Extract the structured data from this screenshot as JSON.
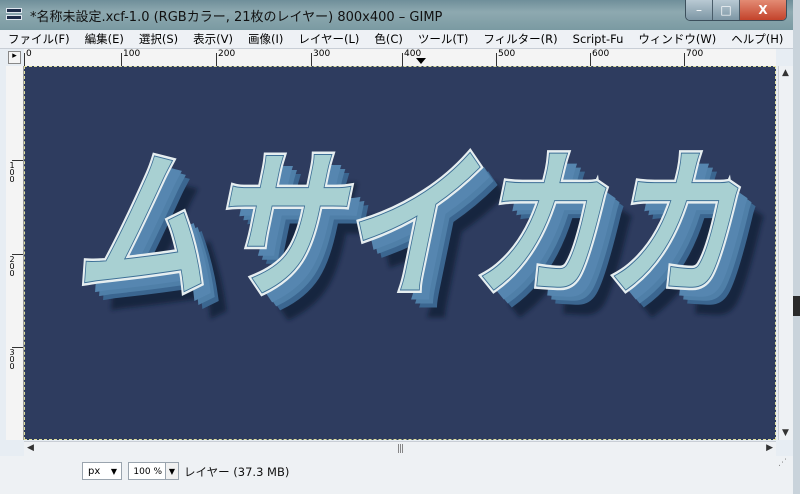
{
  "window": {
    "title": "*名称未設定.xcf-1.0 (RGBカラー, 21枚のレイヤー) 800x400 – GIMP",
    "icon": "gimp-image-icon",
    "minimize": "–",
    "maximize": "□",
    "close": "X"
  },
  "menu": [
    "ファイル(F)",
    "編集(E)",
    "選択(S)",
    "表示(V)",
    "画像(I)",
    "レイヤー(L)",
    "色(C)",
    "ツール(T)",
    "フィルター(R)",
    "Script-Fu",
    "ウィンドウ(W)",
    "ヘルプ(H)"
  ],
  "ruler": {
    "h_labels": [
      "0",
      "100",
      "200",
      "300",
      "400",
      "500",
      "600",
      "700"
    ],
    "v_labels": [
      "100",
      "200",
      "300"
    ]
  },
  "canvas": {
    "text": "ムサイカカ",
    "background_color": "#2e3c5f",
    "fill_color": "#a8d0d2",
    "extrude_color": "#4f7fa8",
    "outline_color": "#e6eef0"
  },
  "status": {
    "unit": "px",
    "zoom": "100 %",
    "layer_info": "レイヤー (37.3 MB)"
  }
}
